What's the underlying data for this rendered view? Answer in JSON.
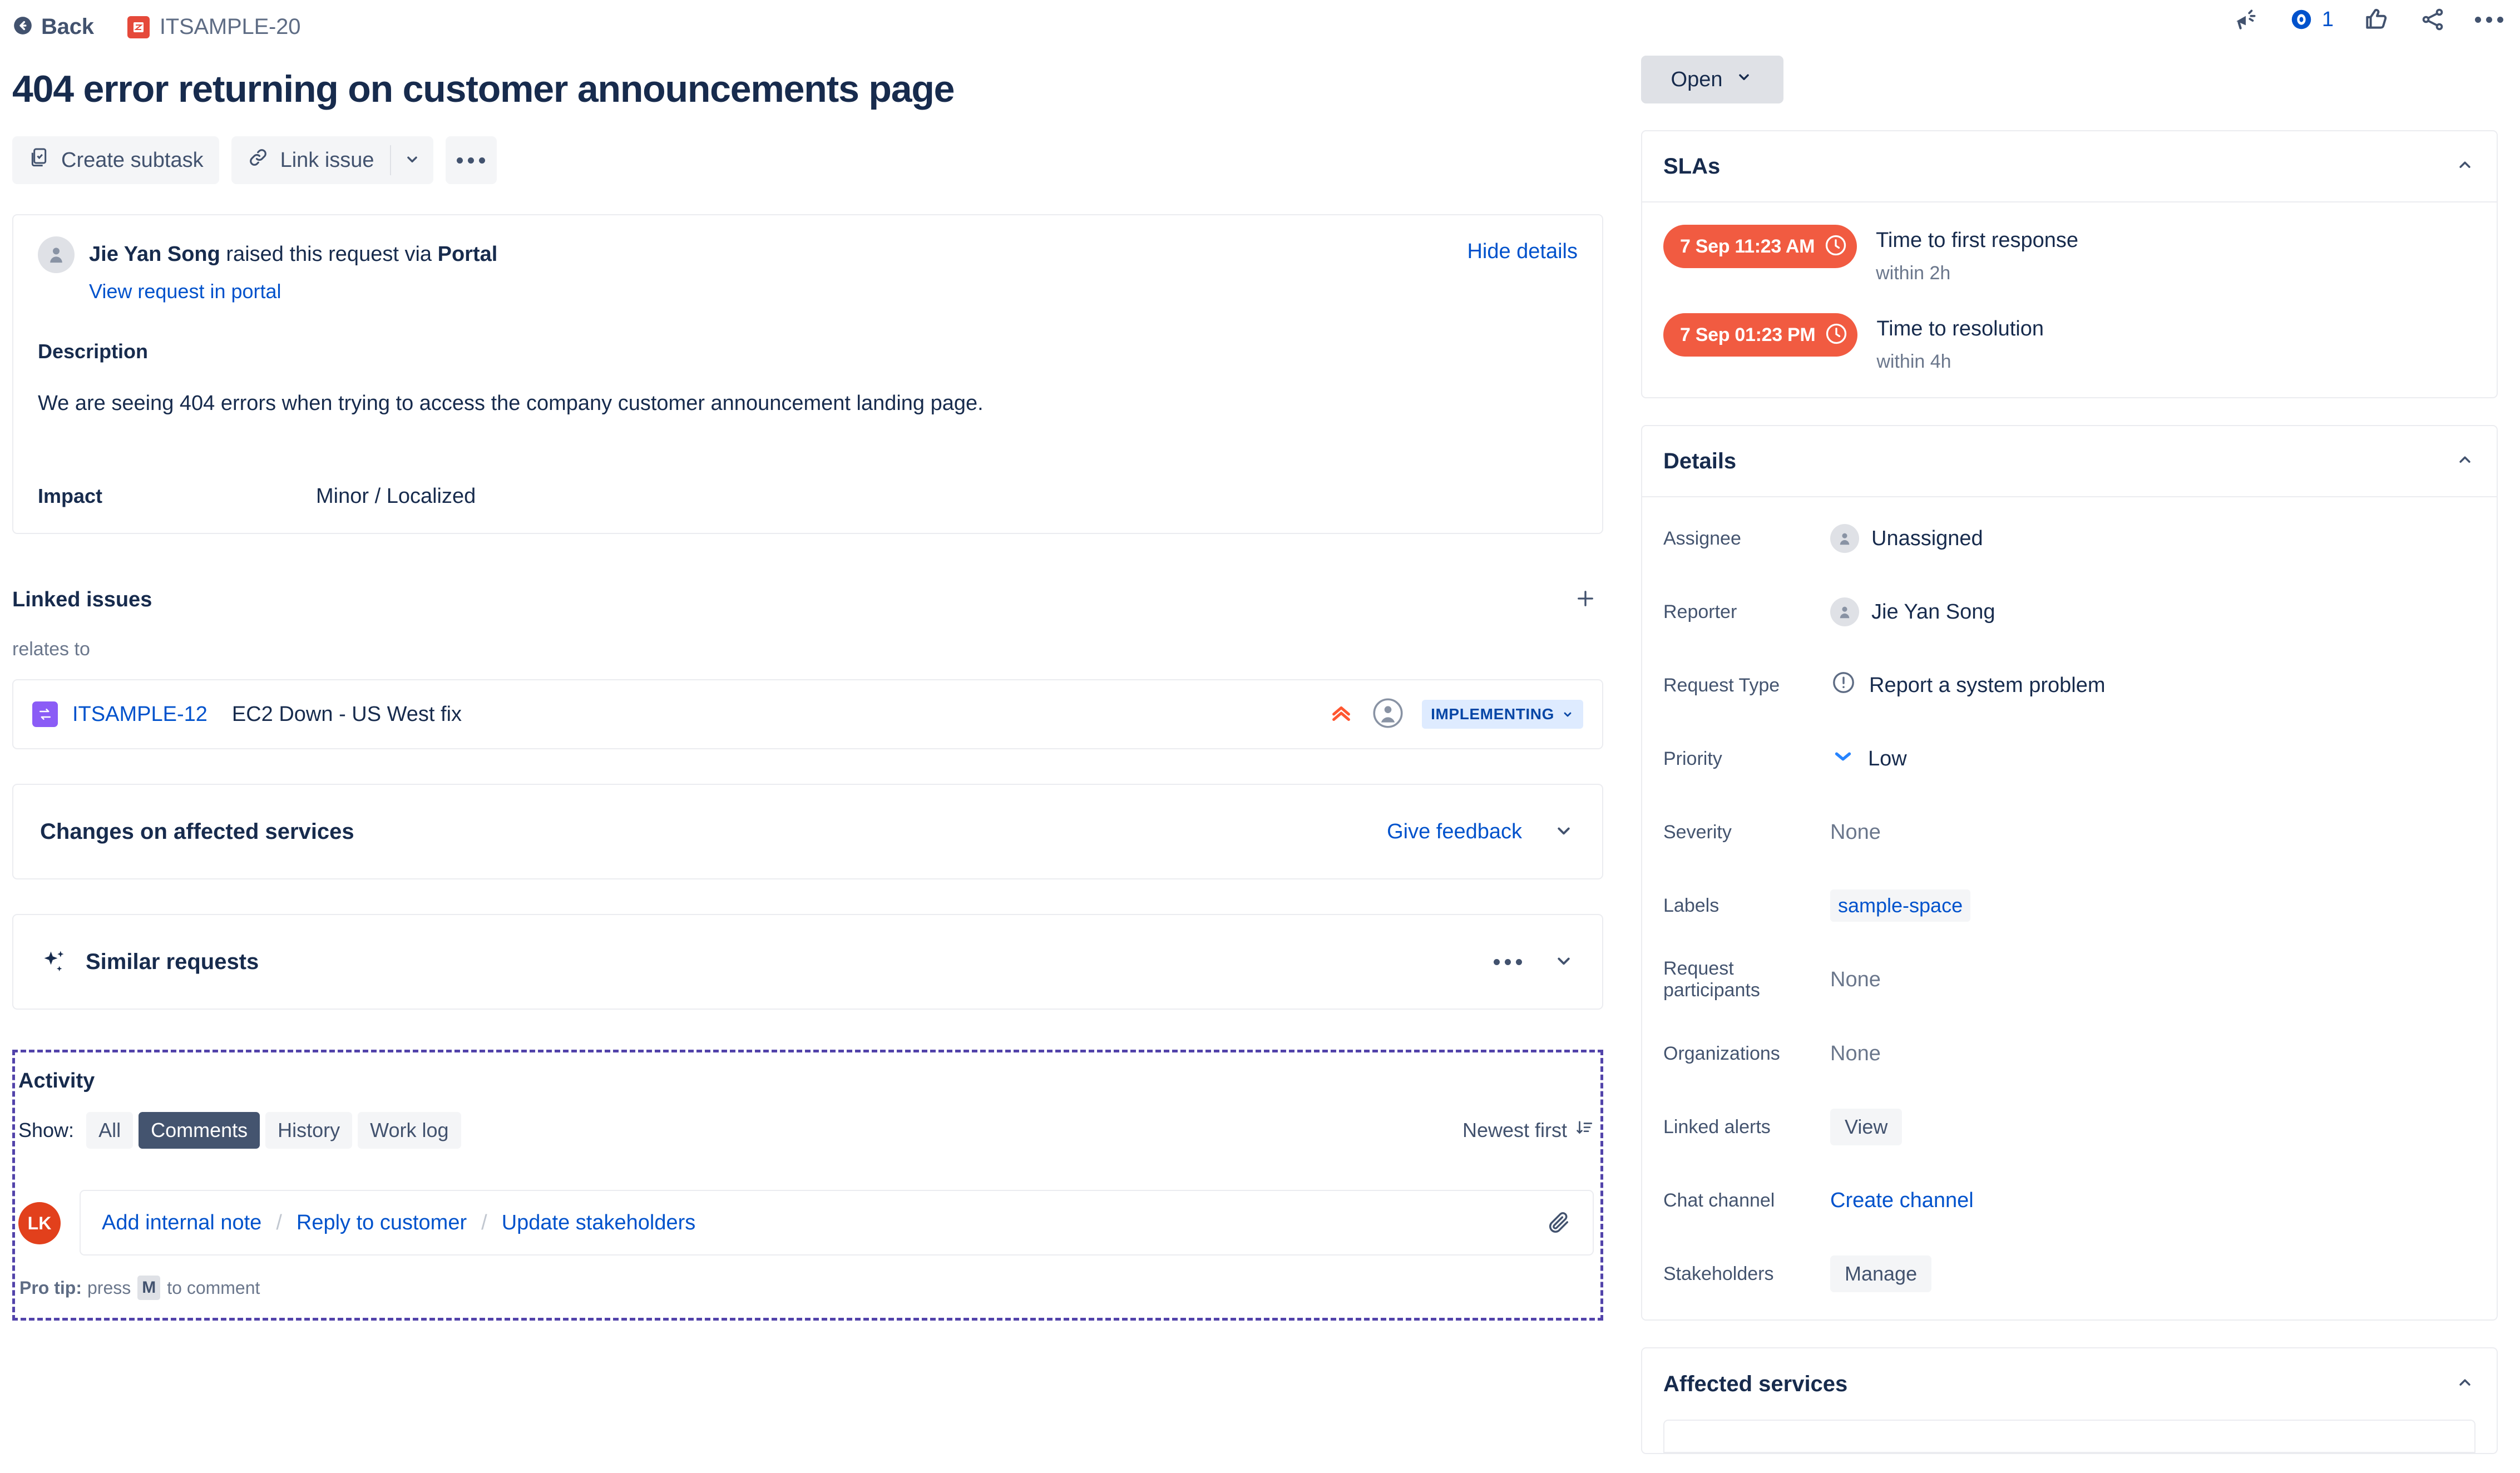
{
  "topbar": {
    "back_label": "Back",
    "issue_key": "ITSAMPLE-20",
    "watch_count": "1"
  },
  "title": "404 error returning on customer announcements page",
  "toolbar": {
    "create_subtask": "Create subtask",
    "link_issue": "Link issue"
  },
  "request": {
    "reporter_name": "Jie Yan Song",
    "raised_text": " raised this request via ",
    "channel": "Portal",
    "hide_details": "Hide details",
    "view_in_portal": "View request in portal",
    "description_label": "Description",
    "description_body": "We are seeing 404 errors when trying to access the company customer announcement landing page.",
    "impact_label": "Impact",
    "impact_value": "Minor / Localized"
  },
  "linked_issues": {
    "title": "Linked issues",
    "relation": "relates to",
    "rows": [
      {
        "key": "ITSAMPLE-12",
        "summary": "EC2 Down - US West fix",
        "status": "IMPLEMENTING"
      }
    ]
  },
  "changes_card": {
    "title": "Changes on affected services",
    "feedback_link": "Give feedback"
  },
  "similar_card": {
    "title": "Similar requests"
  },
  "activity": {
    "title": "Activity",
    "show_label": "Show:",
    "filters": [
      "All",
      "Comments",
      "History",
      "Work log"
    ],
    "active_filter": "Comments",
    "sort_label": "Newest first",
    "avatar_initials": "LK",
    "comment_actions": [
      "Add internal note",
      "Reply to customer",
      "Update stakeholders"
    ],
    "action_separator": "/",
    "protip_prefix": "Pro tip:",
    "protip_press": "press",
    "protip_key": "M",
    "protip_suffix": "to comment"
  },
  "sidebar": {
    "status": "Open",
    "slas": {
      "title": "SLAs",
      "items": [
        {
          "time": "7 Sep 11:23 AM",
          "name": "Time to first response",
          "within": "within 2h"
        },
        {
          "time": "7 Sep 01:23 PM",
          "name": "Time to resolution",
          "within": "within 4h"
        }
      ]
    },
    "details": {
      "title": "Details",
      "fields": [
        {
          "label": "Assignee",
          "value": "Unassigned",
          "kind": "avatar"
        },
        {
          "label": "Reporter",
          "value": "Jie Yan Song",
          "kind": "avatar"
        },
        {
          "label": "Request Type",
          "value": "Report a system problem",
          "kind": "alert"
        },
        {
          "label": "Priority",
          "value": "Low",
          "kind": "priority-low"
        },
        {
          "label": "Severity",
          "value": "None",
          "kind": "muted"
        },
        {
          "label": "Labels",
          "value": "sample-space",
          "kind": "chip"
        },
        {
          "label": "Request participants",
          "value": "None",
          "kind": "muted"
        },
        {
          "label": "Organizations",
          "value": "None",
          "kind": "muted"
        },
        {
          "label": "Linked alerts",
          "value": "View",
          "kind": "button"
        },
        {
          "label": "Chat channel",
          "value": "Create channel",
          "kind": "link"
        },
        {
          "label": "Stakeholders",
          "value": "Manage",
          "kind": "button"
        }
      ]
    },
    "affected_services": {
      "title": "Affected services"
    }
  },
  "colors": {
    "link": "#0052CC",
    "sla_red": "#F15B41",
    "avatar_red": "#E2401C",
    "highlight_purple": "#5243AA",
    "status_chip_bg": "#DEEBFF",
    "change_icon_purple": "#8B5CF6",
    "jira_key_red": "#E5493A"
  }
}
